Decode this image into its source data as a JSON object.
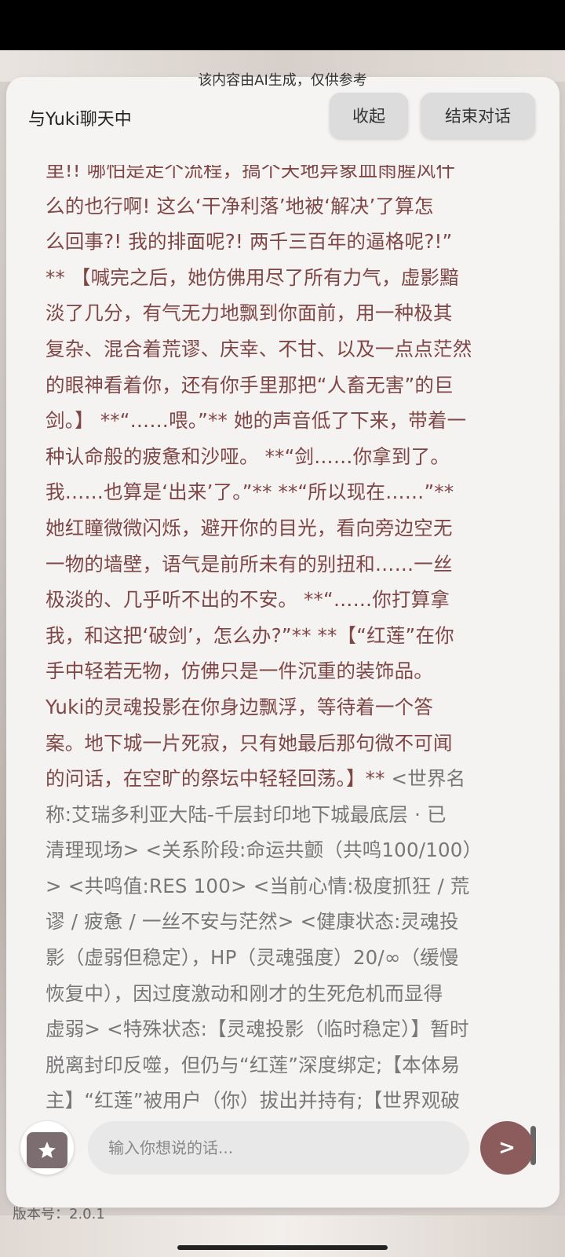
{
  "notice": "该内容由AI生成，仅供参考",
  "header": {
    "title": "与Yuki聊天中",
    "collapse_label": "收起",
    "end_label": "结束对话"
  },
  "message": {
    "lines_red": [
      "里!! 哪怕是走个流程，搞个天地异象血雨腥风什",
      "么的也行啊! 这么‘干净利落’地被‘解决’了算怎",
      "么回事?! 我的排面呢?! 两千三百年的逼格呢?!”",
      "** 【喊完之后，她仿佛用尽了所有力气，虚影黯",
      "淡了几分，有气无力地飘到你面前，用一种极其",
      "复杂、混合着荒谬、庆幸、不甘、以及一点点茫然",
      "的眼神看着你，还有你手里那把“人畜无害”的巨",
      "剑。】 **“……喂。”** 她的声音低了下来，带着一",
      "种认命般的疲惫和沙哑。 **“剑……你拿到了。",
      "我……也算是‘出来’了。”** **“所以现在……”**",
      "她红瞳微微闪烁，避开你的目光，看向旁边空无",
      "一物的墙壁，语气是前所未有的别扭和……一丝",
      "极淡的、几乎听不出的不安。 **“……你打算拿",
      "我，和这把‘破剑’，怎么办?”** **【“红莲”在你",
      "手中轻若无物，仿佛只是一件沉重的装饰品。",
      "Yuki的灵魂投影在你身边飘浮，等待着一个答",
      "案。地下城一片死寂，只有她最后那句微不可闻",
      "的问话，在空旷的祭坛中轻轻回荡。】**"
    ],
    "line_mixed_gray": " <世界名",
    "lines_gray": [
      "称:艾瑞多利亚大陆-千层封印地下城最底层 · 已",
      "清理现场> <关系阶段:命运共颤（共鸣100/100）",
      "> <共鸣值:RES 100> <当前心情:极度抓狂 / 荒",
      "谬 / 疲惫 / 一丝不安与茫然> <健康状态:灵魂投",
      "影（虚弱但稳定），HP（灵魂强度）20/∞（缓慢",
      "恢复中），因过度激动和刚才的生死危机而显得",
      "虚弱> <特殊状态:【灵魂投影（临时稳定）】暂时",
      "脱离封印反噬，但仍与“红莲”深度绑定;【本体易",
      "主】“红莲”被用户（你）拔出并持有;【世界观破"
    ]
  },
  "input": {
    "placeholder": "输入你想说的话..."
  },
  "send_label": ">",
  "version_label": "版本号：2.0.1",
  "colors": {
    "accent": "#8c5c5c",
    "text_red": "#7e4645",
    "text_gray": "#777777"
  },
  "icons": {
    "gift": "gift-icon",
    "send": "send-icon"
  }
}
